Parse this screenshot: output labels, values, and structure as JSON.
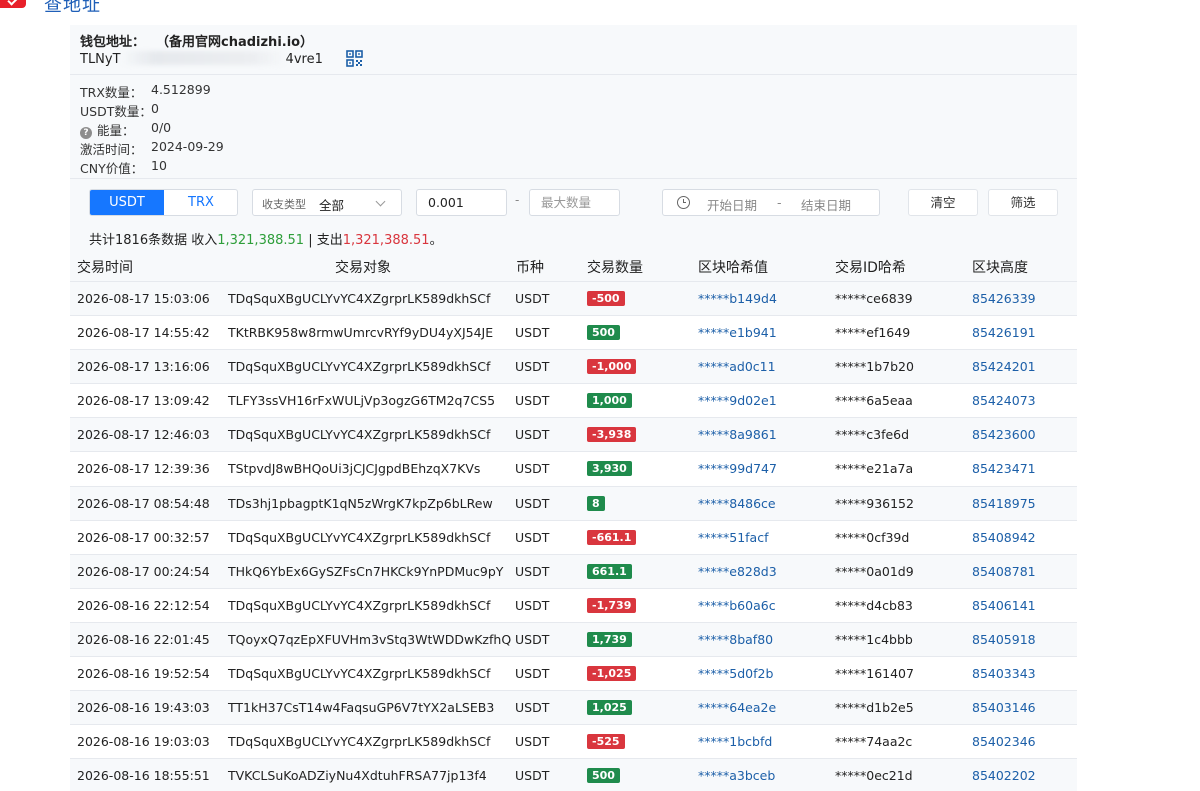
{
  "colors": {
    "primary": "#1677ff",
    "income": "#2e9e3a",
    "expense": "#d9363e",
    "positive_badge": "#1f8b4c",
    "link": "#1c5fa8"
  },
  "header": {
    "title": "查地址",
    "logo_icon": "check-logo-icon"
  },
  "wallet": {
    "address_label": "钱包地址：",
    "mirror_text": "（备用官网chadizhi.io）",
    "address_prefix": "TLNyT",
    "address_suffix": "4vre1",
    "qr_icon": "qr-code-icon"
  },
  "info": [
    {
      "key": "TRX数量：",
      "value": "4.512899"
    },
    {
      "key": "USDT数量：",
      "value": "0"
    },
    {
      "key": "能量：",
      "value": "0/0"
    },
    {
      "key": "激活时间：",
      "value": "2024-09-29"
    },
    {
      "key": "CNY价值：",
      "value": "10"
    }
  ],
  "filters": {
    "tab_usdt": "USDT",
    "tab_trx": "TRX",
    "type_label": "收支类型",
    "type_value": "全部",
    "min_value": "0.001",
    "range_dash": "-",
    "max_placeholder": "最大数量",
    "start_date": "开始日期",
    "date_dash": "-",
    "end_date": "结束日期",
    "clear": "清空",
    "filter": "筛选"
  },
  "summary": {
    "prefix": "共计1816条数据 收入",
    "income": "1,321,388.51",
    "sep": " | 支出",
    "expense": "1,321,388.51",
    "suffix": "。"
  },
  "table": {
    "headers": [
      "交易时间",
      "交易对象",
      "币种",
      "交易数量",
      "区块哈希值",
      "交易ID哈希",
      "区块高度"
    ],
    "rows": [
      {
        "time": "2026-08-17 15:03:06",
        "target": "TDqSquXBgUCLYvYC4XZgrprLK589dkhSCf",
        "currency": "USDT",
        "amount": "-500",
        "sign": "neg",
        "block_hash": "*****b149d4",
        "tx_hash": "*****ce6839",
        "height": "85426339"
      },
      {
        "time": "2026-08-17 14:55:42",
        "target": "TKtRBK958w8rmwUmrcvRYf9yDU4yXJ54JE",
        "currency": "USDT",
        "amount": "500",
        "sign": "pos",
        "block_hash": "*****e1b941",
        "tx_hash": "*****ef1649",
        "height": "85426191"
      },
      {
        "time": "2026-08-17 13:16:06",
        "target": "TDqSquXBgUCLYvYC4XZgrprLK589dkhSCf",
        "currency": "USDT",
        "amount": "-1,000",
        "sign": "neg",
        "block_hash": "*****ad0c11",
        "tx_hash": "*****1b7b20",
        "height": "85424201"
      },
      {
        "time": "2026-08-17 13:09:42",
        "target": "TLFY3ssVH16rFxWULjVp3ogzG6TM2q7CS5",
        "currency": "USDT",
        "amount": "1,000",
        "sign": "pos",
        "block_hash": "*****9d02e1",
        "tx_hash": "*****6a5eaa",
        "height": "85424073"
      },
      {
        "time": "2026-08-17 12:46:03",
        "target": "TDqSquXBgUCLYvYC4XZgrprLK589dkhSCf",
        "currency": "USDT",
        "amount": "-3,938",
        "sign": "neg",
        "block_hash": "*****8a9861",
        "tx_hash": "*****c3fe6d",
        "height": "85423600"
      },
      {
        "time": "2026-08-17 12:39:36",
        "target": "TStpvdJ8wBHQoUi3jCJCJgpdBEhzqX7KVs",
        "currency": "USDT",
        "amount": "3,930",
        "sign": "pos",
        "block_hash": "*****99d747",
        "tx_hash": "*****e21a7a",
        "height": "85423471"
      },
      {
        "time": "2026-08-17 08:54:48",
        "target": "TDs3hj1pbagptK1qN5zWrgK7kpZp6bLRew",
        "currency": "USDT",
        "amount": "8",
        "sign": "pos",
        "block_hash": "*****8486ce",
        "tx_hash": "*****936152",
        "height": "85418975"
      },
      {
        "time": "2026-08-17 00:32:57",
        "target": "TDqSquXBgUCLYvYC4XZgrprLK589dkhSCf",
        "currency": "USDT",
        "amount": "-661.1",
        "sign": "neg",
        "block_hash": "*****51facf",
        "tx_hash": "*****0cf39d",
        "height": "85408942"
      },
      {
        "time": "2026-08-17 00:24:54",
        "target": "THkQ6YbEx6GySZFsCn7HKCk9YnPDMuc9pY",
        "currency": "USDT",
        "amount": "661.1",
        "sign": "pos",
        "block_hash": "*****e828d3",
        "tx_hash": "*****0a01d9",
        "height": "85408781"
      },
      {
        "time": "2026-08-16 22:12:54",
        "target": "TDqSquXBgUCLYvYC4XZgrprLK589dkhSCf",
        "currency": "USDT",
        "amount": "-1,739",
        "sign": "neg",
        "block_hash": "*****b60a6c",
        "tx_hash": "*****d4cb83",
        "height": "85406141"
      },
      {
        "time": "2026-08-16 22:01:45",
        "target": "TQoyxQ7qzEpXFUVHm3vStq3WtWDDwKzfhQ",
        "currency": "USDT",
        "amount": "1,739",
        "sign": "pos",
        "block_hash": "*****8baf80",
        "tx_hash": "*****1c4bbb",
        "height": "85405918"
      },
      {
        "time": "2026-08-16 19:52:54",
        "target": "TDqSquXBgUCLYvYC4XZgrprLK589dkhSCf",
        "currency": "USDT",
        "amount": "-1,025",
        "sign": "neg",
        "block_hash": "*****5d0f2b",
        "tx_hash": "*****161407",
        "height": "85403343"
      },
      {
        "time": "2026-08-16 19:43:03",
        "target": "TT1kH37CsT14w4FaqsuGP6V7tYX2aLSEB3",
        "currency": "USDT",
        "amount": "1,025",
        "sign": "pos",
        "block_hash": "*****64ea2e",
        "tx_hash": "*****d1b2e5",
        "height": "85403146"
      },
      {
        "time": "2026-08-16 19:03:03",
        "target": "TDqSquXBgUCLYvYC4XZgrprLK589dkhSCf",
        "currency": "USDT",
        "amount": "-525",
        "sign": "neg",
        "block_hash": "*****1bcbfd",
        "tx_hash": "*****74aa2c",
        "height": "85402346"
      },
      {
        "time": "2026-08-16 18:55:51",
        "target": "TVKCLSuKoADZiyNu4XdtuhFRSA77jp13f4",
        "currency": "USDT",
        "amount": "500",
        "sign": "pos",
        "block_hash": "*****a3bceb",
        "tx_hash": "*****0ec21d",
        "height": "85402202"
      }
    ]
  }
}
